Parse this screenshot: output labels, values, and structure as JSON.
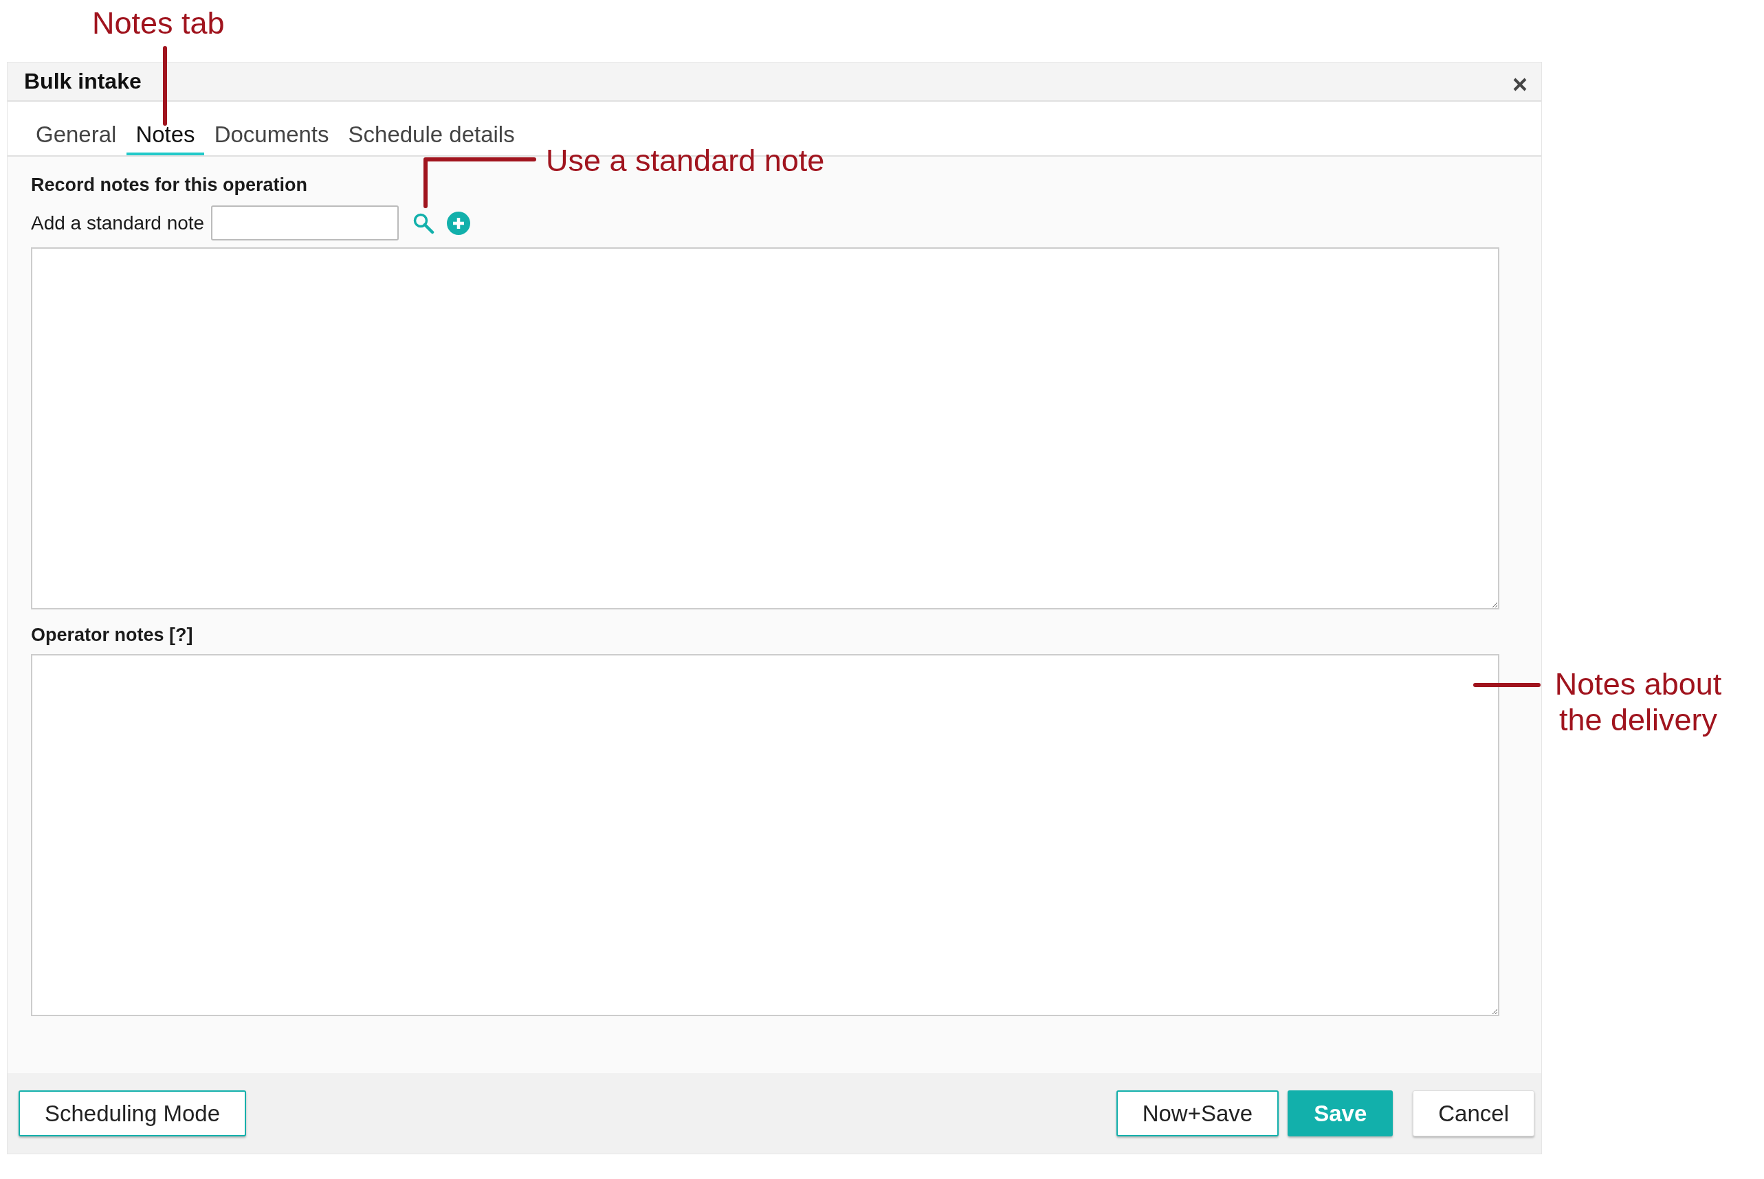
{
  "window": {
    "title": "Bulk intake"
  },
  "tabs": [
    {
      "label": "General",
      "selected": false
    },
    {
      "label": "Notes",
      "selected": true
    },
    {
      "label": "Documents",
      "selected": false
    },
    {
      "label": "Schedule details",
      "selected": false
    }
  ],
  "notes": {
    "heading": "Record notes for this operation",
    "standard_note_label": "Add a standard note"
  },
  "operator_notes": {
    "label": "Operator notes [?]"
  },
  "footer": {
    "left_buttons": [
      {
        "label": "Scheduling Mode",
        "kind": "outline"
      }
    ],
    "right_buttons": [
      {
        "label": "Now+Save",
        "kind": "outline"
      },
      {
        "label": "Save",
        "kind": "primary"
      },
      {
        "label": "Cancel",
        "kind": "plain"
      }
    ]
  },
  "annotations": [
    {
      "text": "Notes tab",
      "kind": "down"
    },
    {
      "text": "Use a standard note",
      "kind": "elbow"
    },
    {
      "text": "Notes about the delivery",
      "kind": "left"
    }
  ]
}
